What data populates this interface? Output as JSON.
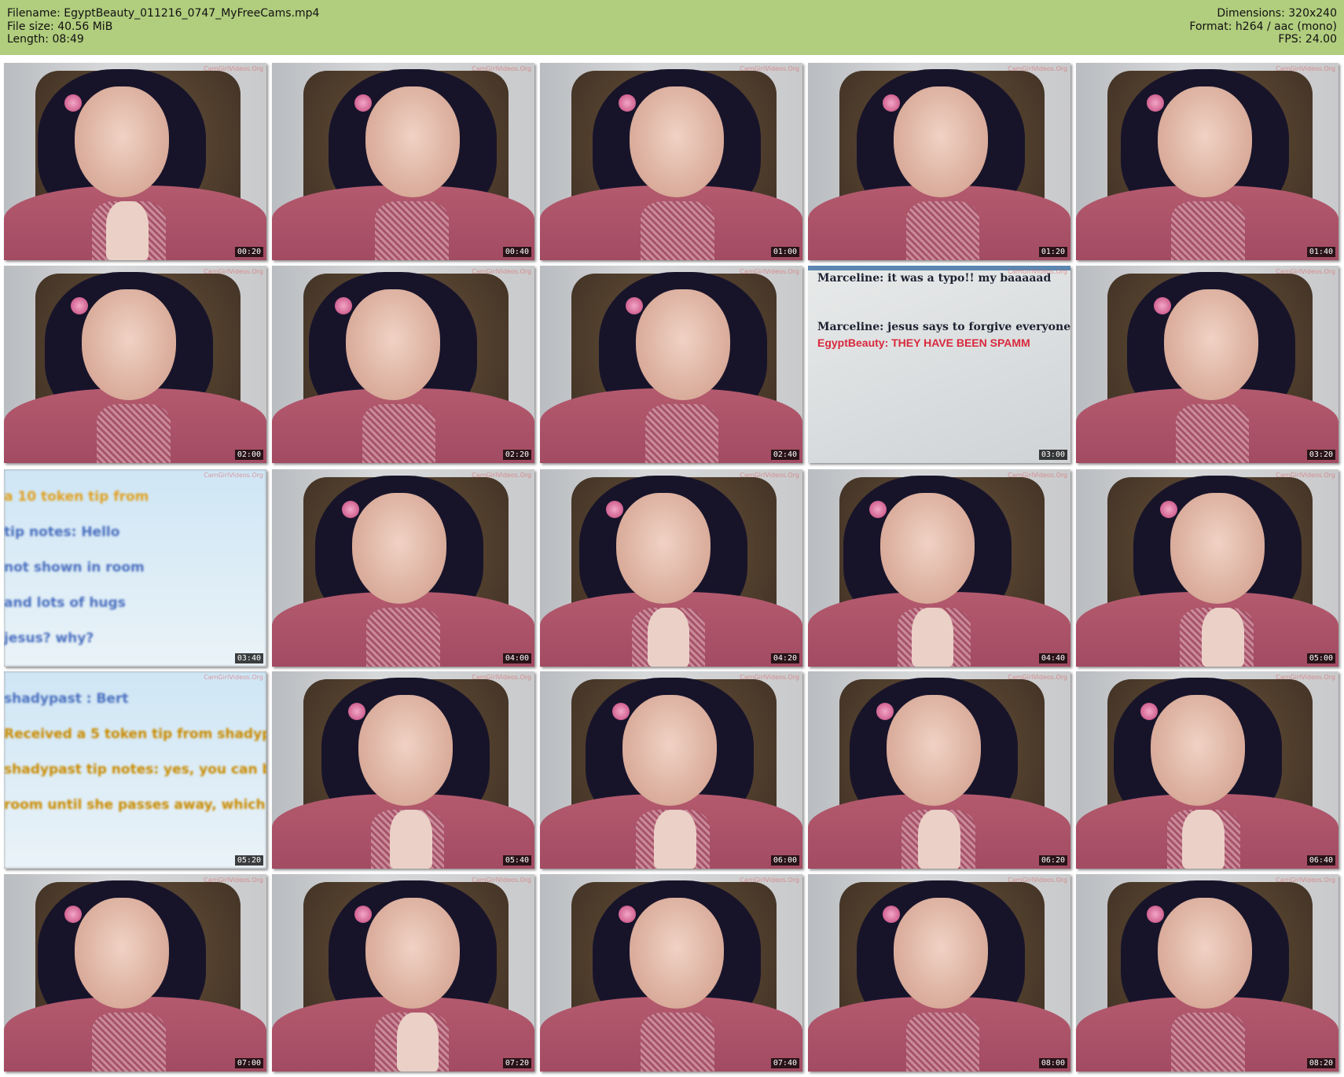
{
  "header": {
    "filename": "Filename: EgyptBeauty_011216_0747_MyFreeCams.mp4",
    "filesize": "File size: 40.56 MiB",
    "length": "Length: 08:49",
    "dimensions": "Dimensions: 320x240",
    "format": "Format: h264 / aac (mono)",
    "fps": "FPS: 24.00"
  },
  "watermark": "CamGirlVideos.Org",
  "frames": [
    {
      "time": "00:20",
      "kind": "cam",
      "hand": true
    },
    {
      "time": "00:40",
      "kind": "cam"
    },
    {
      "time": "01:00",
      "kind": "cam"
    },
    {
      "time": "01:20",
      "kind": "cam"
    },
    {
      "time": "01:40",
      "kind": "cam"
    },
    {
      "time": "02:00",
      "kind": "cam"
    },
    {
      "time": "02:20",
      "kind": "cam"
    },
    {
      "time": "02:40",
      "kind": "cam"
    },
    {
      "time": "03:00",
      "kind": "chat",
      "lines": [
        {
          "text": "Marceline: it was a typo!! my baaaaad",
          "style": "serif"
        },
        {
          "text": "Marceline: jesus says to forgive everyone",
          "style": "serif"
        },
        {
          "text": "EgyptBeauty: THEY HAVE BEEN SPAMM",
          "style": "red"
        }
      ]
    },
    {
      "time": "03:20",
      "kind": "cam"
    },
    {
      "time": "03:40",
      "kind": "blur",
      "lines": [
        {
          "text": "a 10 token tip from",
          "color": "#e0a020"
        },
        {
          "text": "tip notes: Hello",
          "color": "#4a6fbf"
        },
        {
          "text": "not shown in room",
          "color": "#4a6fbf"
        },
        {
          "text": "and lots of hugs",
          "color": "#4a6fbf"
        },
        {
          "text": "jesus? why?",
          "color": "#4a6fbf"
        }
      ]
    },
    {
      "time": "04:00",
      "kind": "cam"
    },
    {
      "time": "04:20",
      "kind": "cam",
      "hand": true
    },
    {
      "time": "04:40",
      "kind": "cam",
      "hand": true
    },
    {
      "time": "05:00",
      "kind": "cam",
      "hand": true
    },
    {
      "time": "05:20",
      "kind": "blur",
      "lines": [
        {
          "text": "shadypast :        Bert",
          "color": "#4a6fbf"
        },
        {
          "text": "Received a 5 token tip from shadyp",
          "color": "#c98a00"
        },
        {
          "text": "shadypast tip notes: yes, you can ba",
          "color": "#c98a00"
        },
        {
          "text": "room until she passes away, which w",
          "color": "#c98a00"
        }
      ]
    },
    {
      "time": "05:40",
      "kind": "cam",
      "hand": true
    },
    {
      "time": "06:00",
      "kind": "cam",
      "hand": true
    },
    {
      "time": "06:20",
      "kind": "cam",
      "hand": true
    },
    {
      "time": "06:40",
      "kind": "cam",
      "hand": true
    },
    {
      "time": "07:00",
      "kind": "cam"
    },
    {
      "time": "07:20",
      "kind": "cam",
      "hand": true
    },
    {
      "time": "07:40",
      "kind": "cam"
    },
    {
      "time": "08:00",
      "kind": "cam"
    },
    {
      "time": "08:20",
      "kind": "cam"
    }
  ]
}
